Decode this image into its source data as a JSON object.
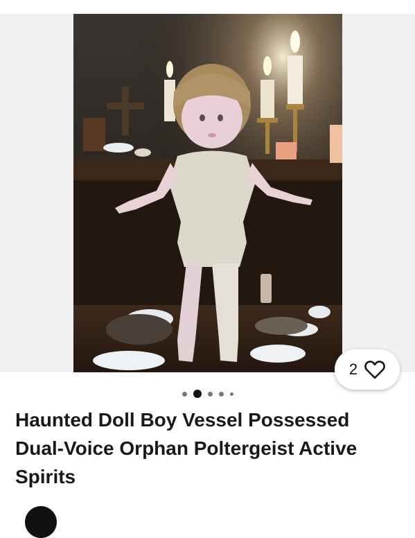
{
  "listing": {
    "title": "Haunted Doll Boy Vessel Possessed Dual-Voice Orphan Poltergeist Active Spirits",
    "likes": "2",
    "like_icon": "heart-outline-icon"
  },
  "gallery": {
    "image_count": 5,
    "active_index": 1
  },
  "colors": {
    "accent": "#191919",
    "gallery_bg": "#f0f0f0"
  }
}
